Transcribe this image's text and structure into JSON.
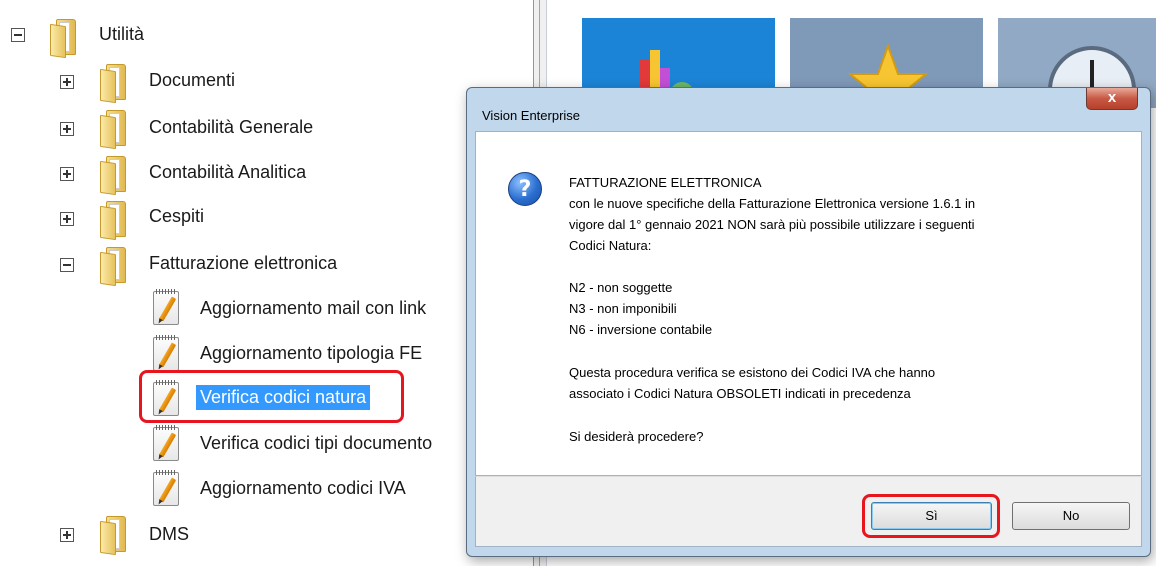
{
  "tree": {
    "root": "Utilità",
    "items": [
      {
        "label": "Documenti"
      },
      {
        "label": "Contabilità Generale"
      },
      {
        "label": "Contabilità Analitica"
      },
      {
        "label": "Cespiti"
      },
      {
        "label": "Fatturazione elettronica"
      },
      {
        "label": "Aggiornamento mail con link"
      },
      {
        "label": "Aggiornamento tipologia FE"
      },
      {
        "label": "Verifica codici natura"
      },
      {
        "label": "Verifica codici tipi documento"
      },
      {
        "label": "Aggiornamento codici IVA"
      },
      {
        "label": "DMS"
      }
    ]
  },
  "dialog": {
    "title": "Vision Enterprise",
    "close": "x",
    "lines": [
      "FATTURAZIONE ELETTRONICA",
      "con le nuove specifiche della Fatturazione Elettronica versione 1.6.1 in",
      "vigore dal 1° gennaio 2021 NON sarà più possibile utilizzare i seguenti",
      "Codici Natura:",
      "N2 - non soggette",
      "N3 - non imponibili",
      "N6 - inversione contabile",
      "Questa procedura verifica se esistono dei Codici IVA che hanno",
      "associato i Codici Natura OBSOLETI indicati in precedenza",
      "Si desiderà procedere?"
    ],
    "buttons": {
      "yes": "Sì",
      "no": "No"
    }
  },
  "colors": {
    "highlight": "#e8151f",
    "selection": "#3399ff",
    "tile_blue": "#1c84d6"
  }
}
